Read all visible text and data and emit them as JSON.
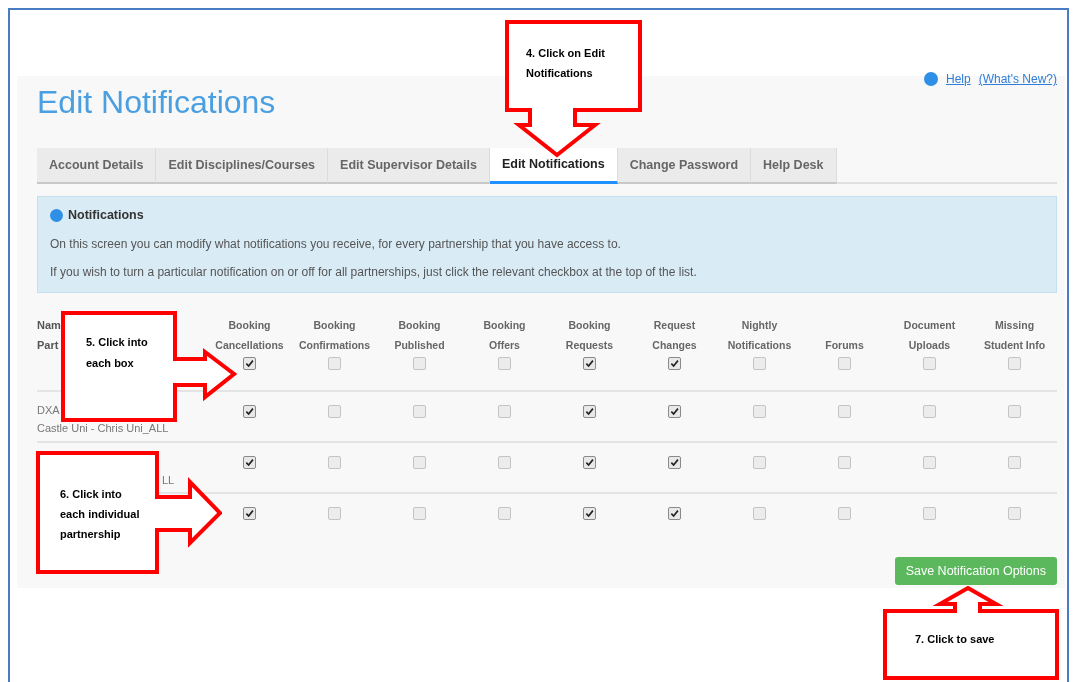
{
  "page": {
    "title": "Edit Notifications",
    "links": [
      "Help",
      "(What's New?)"
    ]
  },
  "tabs": [
    {
      "label": "Account Details",
      "selected": false
    },
    {
      "label": "Edit Disciplines/Courses",
      "selected": false
    },
    {
      "label": "Edit Supervisor Details",
      "selected": false
    },
    {
      "label": "Edit Notifications",
      "selected": true
    },
    {
      "label": "Change Password",
      "selected": false
    },
    {
      "label": "Help Desk",
      "selected": false
    }
  ],
  "info": {
    "title": "Notifications",
    "lines": [
      "On this screen you can modify what notifications you receive, for every partnership that you have access to.",
      "If you wish to turn a particular notification on or off for all partnerships, just click the relevant checkbox at the top of the list."
    ]
  },
  "table": {
    "name_header": [
      "Nam",
      "Part"
    ],
    "columns": [
      [
        "Booking",
        "Cancellations"
      ],
      [
        "Booking",
        "Confirmations"
      ],
      [
        "Booking",
        "Published"
      ],
      [
        "Booking",
        "Offers"
      ],
      [
        "Booking",
        "Requests"
      ],
      [
        "Request",
        "Changes"
      ],
      [
        "Nightly",
        "Notifications"
      ],
      [
        "Forums"
      ],
      [
        "Document",
        "Uploads"
      ],
      [
        "Missing",
        "Student Info"
      ]
    ],
    "all_row": {
      "checks": [
        true,
        false,
        false,
        false,
        true,
        true,
        false,
        false,
        false,
        false
      ]
    },
    "rows": [
      {
        "lines": [
          "DXA",
          "Castle Uni - Chris Uni_ALL"
        ],
        "checks": [
          true,
          false,
          false,
          false,
          true,
          true,
          false,
          false,
          false,
          false
        ]
      },
      {
        "lines": [
          "LL"
        ],
        "checks": [
          true,
          false,
          false,
          false,
          true,
          true,
          false,
          false,
          false,
          false
        ]
      },
      {
        "checks": [
          true,
          false,
          false,
          false,
          true,
          true,
          false,
          false,
          false,
          false
        ]
      }
    ]
  },
  "save_button": "Save Notification Options",
  "callouts": [
    {
      "text": "4.  Click on Edit Notifications"
    },
    {
      "text": "5. Click into each box"
    },
    {
      "text": "6. Click into each individual partnership"
    },
    {
      "text": "7. Click to save"
    }
  ]
}
